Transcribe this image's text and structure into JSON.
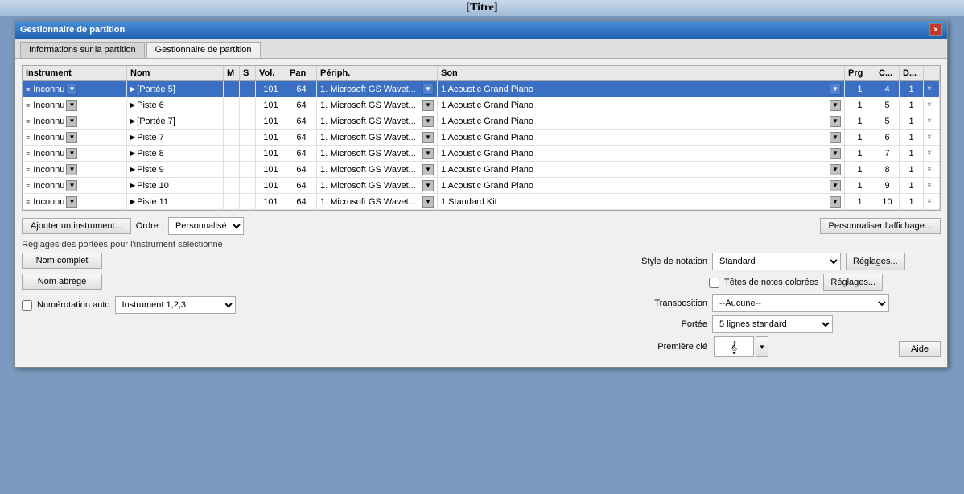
{
  "title": "[Titre]",
  "dialog": {
    "title": "Gestionnaire de partition",
    "close_label": "×",
    "tabs": [
      {
        "id": "info",
        "label": "Informations sur la partition",
        "active": false
      },
      {
        "id": "manager",
        "label": "Gestionnaire de partition",
        "active": true
      }
    ]
  },
  "table": {
    "headers": {
      "instrument": "Instrument",
      "nom": "Nom",
      "m": "M",
      "s": "S",
      "vol": "Vol.",
      "pan": "Pan",
      "periph": "Périph.",
      "son": "Son",
      "prg": "Prg",
      "c": "C...",
      "d": "D..."
    },
    "rows": [
      {
        "instrument": "Inconnu",
        "nom": "[Portée 5]",
        "vol": "101",
        "pan": "64",
        "periph": "1. Microsoft GS Wavet...",
        "son": "1 Acoustic Grand Piano",
        "prg": "1",
        "c": "4",
        "d": "1",
        "selected": true
      },
      {
        "instrument": "Inconnu",
        "nom": "Piste 6",
        "vol": "101",
        "pan": "64",
        "periph": "1. Microsoft GS Wavet...",
        "son": "1 Acoustic Grand Piano",
        "prg": "1",
        "c": "5",
        "d": "1",
        "selected": false
      },
      {
        "instrument": "Inconnu",
        "nom": "[Portée 7]",
        "vol": "101",
        "pan": "64",
        "periph": "1. Microsoft GS Wavet...",
        "son": "1 Acoustic Grand Piano",
        "prg": "1",
        "c": "5",
        "d": "1",
        "selected": false
      },
      {
        "instrument": "Inconnu",
        "nom": "Piste 7",
        "vol": "101",
        "pan": "64",
        "periph": "1. Microsoft GS Wavet...",
        "son": "1 Acoustic Grand Piano",
        "prg": "1",
        "c": "6",
        "d": "1",
        "selected": false
      },
      {
        "instrument": "Inconnu",
        "nom": "Piste 8",
        "vol": "101",
        "pan": "64",
        "periph": "1. Microsoft GS Wavet...",
        "son": "1 Acoustic Grand Piano",
        "prg": "1",
        "c": "7",
        "d": "1",
        "selected": false
      },
      {
        "instrument": "Inconnu",
        "nom": "Piste 9",
        "vol": "101",
        "pan": "64",
        "periph": "1. Microsoft GS Wavet...",
        "son": "1 Acoustic Grand Piano",
        "prg": "1",
        "c": "8",
        "d": "1",
        "selected": false
      },
      {
        "instrument": "Inconnu",
        "nom": "Piste 10",
        "vol": "101",
        "pan": "64",
        "periph": "1. Microsoft GS Wavet...",
        "son": "1 Acoustic Grand Piano",
        "prg": "1",
        "c": "9",
        "d": "1",
        "selected": false
      },
      {
        "instrument": "Inconnu",
        "nom": "Piste 11",
        "vol": "101",
        "pan": "64",
        "periph": "1. Microsoft GS Wavet...",
        "son": "1 Standard Kit",
        "prg": "1",
        "c": "10",
        "d": "1",
        "selected": false
      }
    ]
  },
  "bottom": {
    "add_instrument_label": "Ajouter un instrument...",
    "order_label": "Ordre :",
    "order_value": "Personnalisé",
    "personnaliser_label": "Personnaliser l'affichage...",
    "section_label": "Réglages des portées pour l'instrument sélectionné",
    "nom_complet_label": "Nom complet",
    "nom_abrege_label": "Nom abrégé",
    "numauto_label": "Numérotation auto",
    "numauto_value": "Instrument 1,2,3",
    "style_notation_label": "Style de notation",
    "style_notation_value": "Standard",
    "reglages_label": "Réglages...",
    "tetes_notes_label": "Têtes de notes colorées",
    "reglages2_label": "Réglages...",
    "transposition_label": "Transposition",
    "transposition_value": "--Aucune--",
    "portee_label": "Portée",
    "portee_value": "5 lignes standard",
    "premiere_cle_label": "Première clé",
    "aide_label": "Aide"
  }
}
